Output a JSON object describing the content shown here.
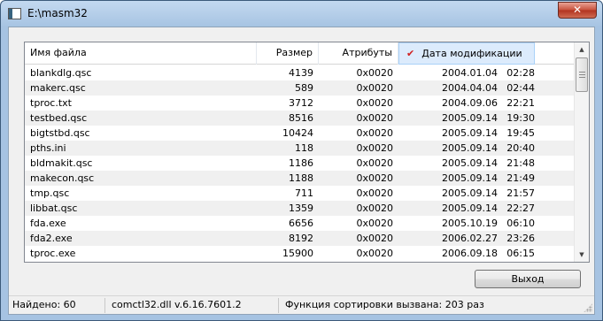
{
  "window": {
    "title": "E:\\masm32",
    "close_glyph": "✕"
  },
  "listview": {
    "columns": [
      {
        "label": "Имя файла"
      },
      {
        "label": "Размер"
      },
      {
        "label": "Атрибуты"
      },
      {
        "label": "Дата модификации",
        "sorted": true,
        "sort_glyph": "✔"
      }
    ],
    "rows": [
      {
        "name": "blankdlg.qsc",
        "size": "4139",
        "attr": "0x0020",
        "date": "2004.01.04",
        "time": "02:28"
      },
      {
        "name": "makerc.qsc",
        "size": "589",
        "attr": "0x0020",
        "date": "2004.04.04",
        "time": "02:44"
      },
      {
        "name": "tproc.txt",
        "size": "3712",
        "attr": "0x0020",
        "date": "2004.09.06",
        "time": "22:21"
      },
      {
        "name": "testbed.qsc",
        "size": "8516",
        "attr": "0x0020",
        "date": "2005.09.14",
        "time": "19:30"
      },
      {
        "name": "bigtstbd.qsc",
        "size": "10424",
        "attr": "0x0020",
        "date": "2005.09.14",
        "time": "19:45"
      },
      {
        "name": "pths.ini",
        "size": "118",
        "attr": "0x0020",
        "date": "2005.09.14",
        "time": "20:40"
      },
      {
        "name": "bldmakit.qsc",
        "size": "1186",
        "attr": "0x0020",
        "date": "2005.09.14",
        "time": "21:48"
      },
      {
        "name": "makecon.qsc",
        "size": "1188",
        "attr": "0x0020",
        "date": "2005.09.14",
        "time": "21:49"
      },
      {
        "name": "tmp.qsc",
        "size": "711",
        "attr": "0x0020",
        "date": "2005.09.14",
        "time": "21:57"
      },
      {
        "name": "libbat.qsc",
        "size": "1359",
        "attr": "0x0020",
        "date": "2005.09.14",
        "time": "22:27"
      },
      {
        "name": "fda.exe",
        "size": "6656",
        "attr": "0x0020",
        "date": "2005.10.19",
        "time": "06:10"
      },
      {
        "name": "fda2.exe",
        "size": "8192",
        "attr": "0x0020",
        "date": "2006.02.27",
        "time": "23:26"
      },
      {
        "name": "tproc.exe",
        "size": "15900",
        "attr": "0x0020",
        "date": "2006.09.18",
        "time": "06:15"
      }
    ]
  },
  "scrollbar": {
    "up_glyph": "▲",
    "down_glyph": "▼"
  },
  "buttons": {
    "exit_label": "Выход"
  },
  "statusbar": {
    "found": "Найдено:  60",
    "dll": "comctl32.dll   v.6.16.7601.2",
    "sort_calls": "Функция сортировки вызвана:  203 раз"
  }
}
